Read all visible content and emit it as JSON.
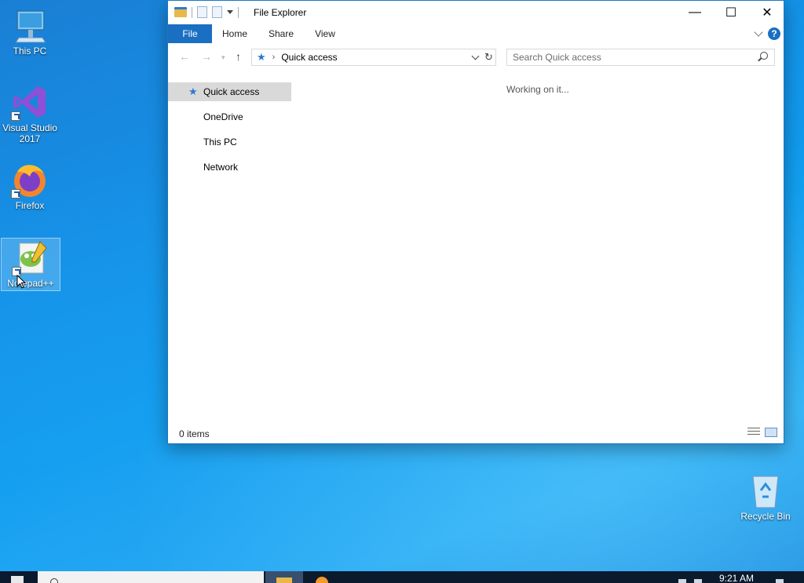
{
  "desktop": {
    "icons": [
      {
        "label": "This PC",
        "icon": "computer-icon"
      },
      {
        "label": "Visual Studio 2017",
        "icon": "visual-studio-icon"
      },
      {
        "label": "Firefox",
        "icon": "firefox-icon"
      },
      {
        "label": "Notepad++",
        "icon": "notepad-plus-plus-icon"
      },
      {
        "label": "Recycle Bin",
        "icon": "recycle-bin-icon"
      }
    ]
  },
  "window": {
    "title": "File Explorer",
    "controls": {
      "minimize": "—",
      "maximize": "☐",
      "close": "✕"
    },
    "ribbon_tabs": [
      "File",
      "Home",
      "Share",
      "View"
    ],
    "help_label": "?",
    "address": {
      "crumb": "Quick access"
    },
    "search": {
      "placeholder": "Search Quick access"
    },
    "nav_items": [
      {
        "label": "Quick access",
        "active": true
      },
      {
        "label": "OneDrive"
      },
      {
        "label": "This PC"
      },
      {
        "label": "Network"
      }
    ],
    "content_status": "Working on it...",
    "status_count": "0 items"
  },
  "taskbar": {
    "clock": "9:21 AM"
  },
  "colors": {
    "accent": "#1a6fc2",
    "desktop": "#1590e6",
    "taskbar": "#0c1a2e"
  }
}
